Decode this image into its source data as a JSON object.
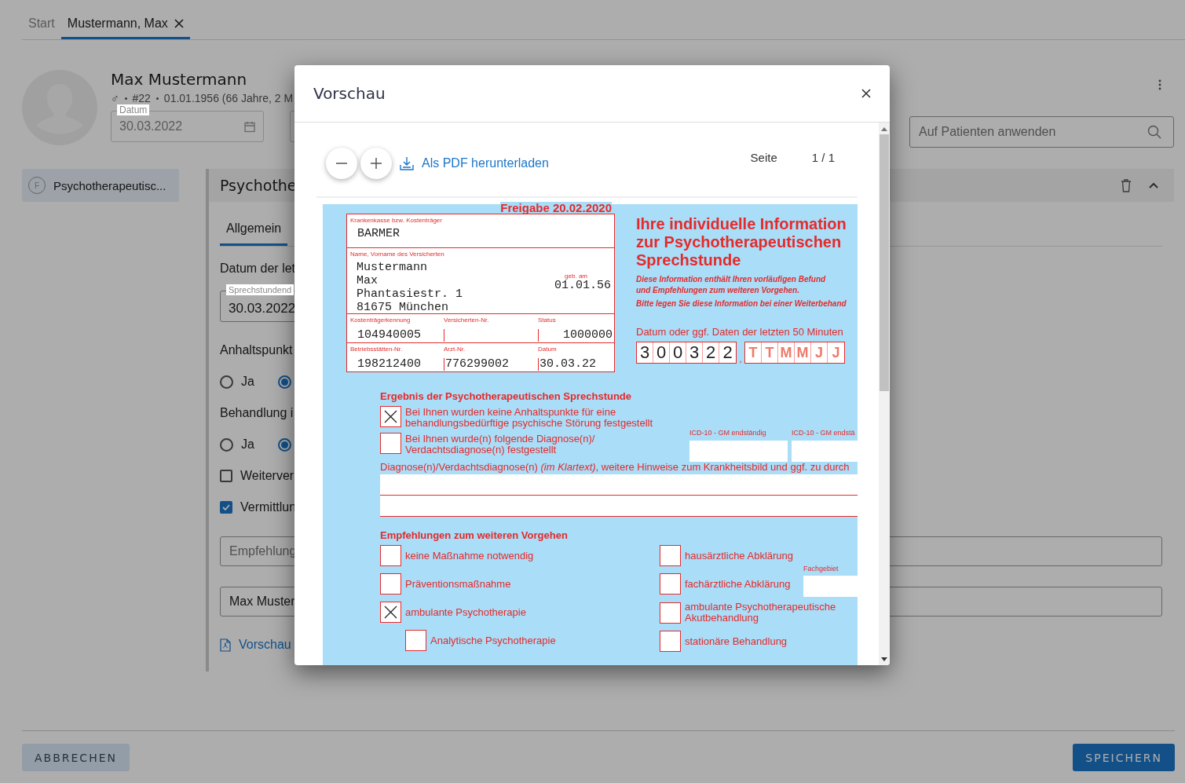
{
  "tabs": [
    {
      "label": "Start",
      "selected": false,
      "closable": false
    },
    {
      "label": "Mustermann, Max",
      "selected": true,
      "closable": true
    }
  ],
  "patient": {
    "name": "Max Mustermann",
    "gender": "♂",
    "number": "#22",
    "birth": "01.01.1956 (66 Jahre, 2 M",
    "date_field": {
      "label": "Datum",
      "value": "30.03.2022"
    }
  },
  "apply_field": {
    "placeholder": "Auf Patienten anwenden"
  },
  "forms": [
    {
      "badge": "F",
      "label": "Psychotherapeutisc...",
      "selected": true
    }
  ],
  "panel": {
    "title": "Psychothe",
    "tabs": [
      {
        "label": "Allgemein",
        "selected": true
      }
    ],
    "items": [
      {
        "kind": "label",
        "text": "Datum der let"
      },
      {
        "kind": "date-field",
        "label": "Sprechstundend",
        "value": "30.03.2022"
      },
      {
        "kind": "label",
        "text": "Anhaltspunkt"
      },
      {
        "kind": "radio",
        "options": [
          {
            "label": "Ja",
            "selected": false
          },
          {
            "selected": true
          }
        ]
      },
      {
        "kind": "label",
        "text": "Behandlung i"
      },
      {
        "kind": "radio",
        "options": [
          {
            "label": "Ja",
            "selected": false
          },
          {
            "selected": true
          }
        ]
      },
      {
        "kind": "checkbox",
        "label": "Weiterver",
        "checked": false
      },
      {
        "kind": "checkbox",
        "label": "Vermittlun",
        "checked": true
      },
      {
        "kind": "number-field",
        "placeholder": "Empfehlung"
      },
      {
        "kind": "select",
        "value": "Max Muster"
      },
      {
        "kind": "link",
        "text": "Vorschau"
      }
    ]
  },
  "footer": {
    "cancel": "ABBRECHEN",
    "save": "SPEICHERN"
  },
  "modal": {
    "title": "Vorschau",
    "download": "Als PDF herunterladen",
    "page_label": "Seite",
    "page": "1 / 1",
    "form": {
      "release": "Freigabe 20.02.2020",
      "insurance_label": "Krankenkasse bzw. Kostenträger",
      "insurance": "BARMER",
      "name_label": "Name, Vorname des Versicherten",
      "name_lines": [
        "Mustermann",
        "Max",
        "Phantasiestr. 1",
        "81675 München"
      ],
      "birth_label": "geb. am",
      "birth": "01.01.56",
      "id_row": [
        {
          "label": "Kostenträgerkennung",
          "value": "104940005"
        },
        {
          "label": "Versicherten-Nr."
        },
        {
          "label": "Status",
          "value": "1000000"
        }
      ],
      "site_row": [
        {
          "label": "Betriebsstätten-Nr.",
          "value": "198212400"
        },
        {
          "label": "Arzt-Nr.",
          "value": "776299002"
        },
        {
          "label": "Datum",
          "value": "30.03.22"
        }
      ],
      "title_lines": [
        "Ihre individuelle Information",
        "zur Psychotherapeutischen",
        "Sprechstunde"
      ],
      "note_lines": [
        "Diese Information enthält Ihren vorläufigen Befund",
        "und Empfehlungen zum weiteren Vorgehen."
      ],
      "note2": "Bitte legen Sie diese Information bei einer Weiterbehand",
      "date_label": "Datum oder ggf. Daten der letzten 50 Minuten",
      "date_digits": [
        "3",
        "0",
        "0",
        "3",
        "2",
        "2"
      ],
      "date_separator": ",",
      "date_placeholders": [
        "T",
        "T",
        "M",
        "M",
        "J",
        "J"
      ],
      "result_heading": "Ergebnis der Psychotherapeutischen Sprechstunde",
      "result_options": [
        {
          "text": "Bei Ihnen wurden keine Anhaltspunkte für eine behandlungsbedürftige psychische Störung festgestellt",
          "checked": true
        },
        {
          "text": "Bei Ihnen wurde(n) folgende Diagnose(n)/ Verdachtsdiagnose(n) festgestellt",
          "checked": false
        }
      ],
      "icd_labels": [
        "ICD-10 - GM endständig",
        "ICD-10 - GM endstä"
      ],
      "diagnosis_label": "Diagnose(n)/Verdachtsdiagnose(n) *(im Klartext)*, weitere Hinweise zum Krankheitsbild und ggf. zu durch",
      "rec_heading": "Empfehlungen zum weiteren Vorgehen",
      "rec_left": [
        {
          "text": "keine Maßnahme notwendig",
          "checked": false
        },
        {
          "text": "Präventionsmaßnahme",
          "checked": false
        },
        {
          "text": "ambulante Psychotherapie",
          "checked": true,
          "children": [
            {
              "text": "Analytische Psychotherapie",
              "checked": false
            }
          ]
        }
      ],
      "rec_right": [
        {
          "text": "hausärztliche Abklärung",
          "checked": false
        },
        {
          "text": "fachärztliche Abklärung",
          "checked": false,
          "field_label": "Fachgebiet"
        },
        {
          "text": "ambulante Psychotherapeutische Akutbehandlung",
          "checked": false
        },
        {
          "text": "stationäre Behandlung",
          "checked": false
        }
      ]
    }
  }
}
